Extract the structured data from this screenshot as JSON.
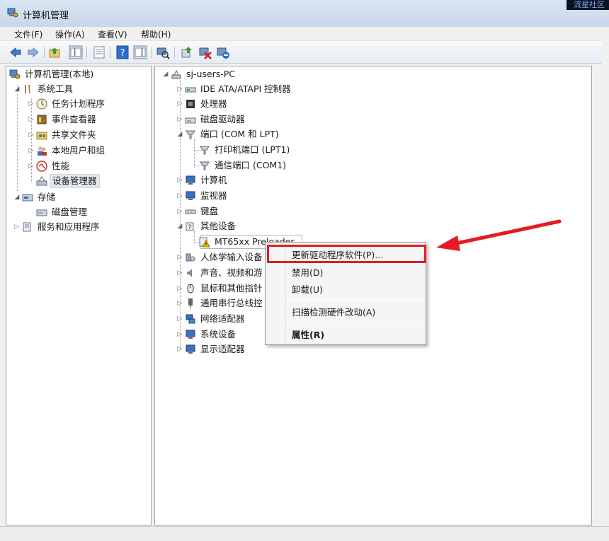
{
  "window": {
    "title": "计算机管理",
    "watermark": "流星社区"
  },
  "menu": [
    "文件(F)",
    "操作(A)",
    "查看(V)",
    "帮助(H)"
  ],
  "toolbar_icons": [
    "back-arrow-icon",
    "forward-arrow-icon",
    "up-folder-icon",
    "show-tree-icon",
    "properties-icon",
    "help-icon",
    "show-action-pane-icon",
    "scan-hardware-icon",
    "update-driver-icon",
    "disable-device-icon",
    "uninstall-device-icon"
  ],
  "left_tree": {
    "root": "计算机管理(本地)",
    "system_tools": "系统工具",
    "task_scheduler": "任务计划程序",
    "event_viewer": "事件查看器",
    "shared_folders": "共享文件夹",
    "local_users": "本地用户和组",
    "performance": "性能",
    "device_manager": "设备管理器",
    "storage": "存储",
    "disk_management": "磁盘管理",
    "services_apps": "服务和应用程序"
  },
  "device_tree": {
    "computer_name": "sj-users-PC",
    "ide": "IDE ATA/ATAPI 控制器",
    "processor": "处理器",
    "disk_drives": "磁盘驱动器",
    "ports": "端口 (COM 和 LPT)",
    "lpt1": "打印机端口 (LPT1)",
    "com1": "通信端口 (COM1)",
    "computer": "计算机",
    "monitors": "监视器",
    "keyboard": "键盘",
    "other_devices": "其他设备",
    "mt65xx": "MT65xx Preloader",
    "hid": "人体学输入设备",
    "sound": "声音、视频和游",
    "mice": "鼠标和其他指针",
    "usb": "通用串行总线控",
    "network": "网络适配器",
    "system_devices": "系统设备",
    "display": "显示适配器"
  },
  "context_menu": {
    "update_driver": "更新驱动程序软件(P)...",
    "disable": "禁用(D)",
    "uninstall": "卸载(U)",
    "scan": "扫描检测硬件改动(A)",
    "properties": "属性(R)"
  },
  "colors": {
    "highlight_box": "#e51b23",
    "arrow": "#e51b23",
    "titlebar": "#c7d7ea"
  }
}
